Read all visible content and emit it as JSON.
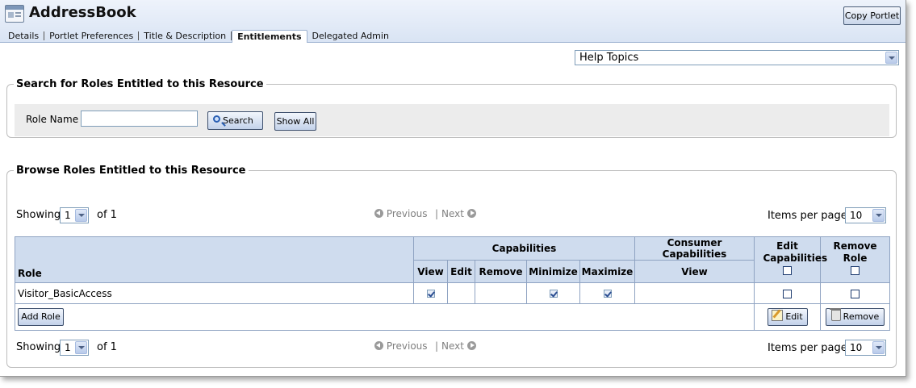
{
  "header": {
    "title": "AddressBook",
    "copy_portlet_label": "Copy Portlet"
  },
  "tabs": [
    {
      "label": "Details"
    },
    {
      "label": "Portlet Preferences"
    },
    {
      "label": "Title & Description"
    },
    {
      "label": "Entitlements",
      "active": true
    },
    {
      "label": "Delegated Admin"
    }
  ],
  "help": {
    "selected": "Help Topics"
  },
  "search_section": {
    "legend": "Search for Roles Entitled to this Resource",
    "role_name_label": "Role Name",
    "role_name_value": "",
    "search_button": "Search",
    "show_all_button": "Show All"
  },
  "browse_section": {
    "legend": "Browse Roles Entitled to this Resource",
    "pager": {
      "showing_label": "Showing",
      "page_value": "1",
      "of_label": "of 1",
      "previous_label": "Previous",
      "separator": "|",
      "next_label": "Next",
      "items_per_page_label": "Items per page",
      "items_per_page_value": "10"
    },
    "table": {
      "role_header": "Role",
      "capabilities_header": "Capabilities",
      "consumer_capabilities_header": "Consumer Capabilities",
      "edit_capabilities_header": "Edit Capabilities",
      "remove_role_header": "Remove Role",
      "cap_cols": [
        "View",
        "Edit",
        "Remove",
        "Minimize",
        "Maximize"
      ],
      "consumer_cols": [
        "View"
      ],
      "rows": [
        {
          "role": "Visitor_BasicAccess",
          "capabilities": [
            true,
            false,
            false,
            true,
            true
          ],
          "consumer_view": false,
          "edit_capabilities": false,
          "remove_role": false
        }
      ],
      "add_role_button": "Add Role",
      "edit_button": "Edit",
      "remove_button": "Remove"
    }
  }
}
